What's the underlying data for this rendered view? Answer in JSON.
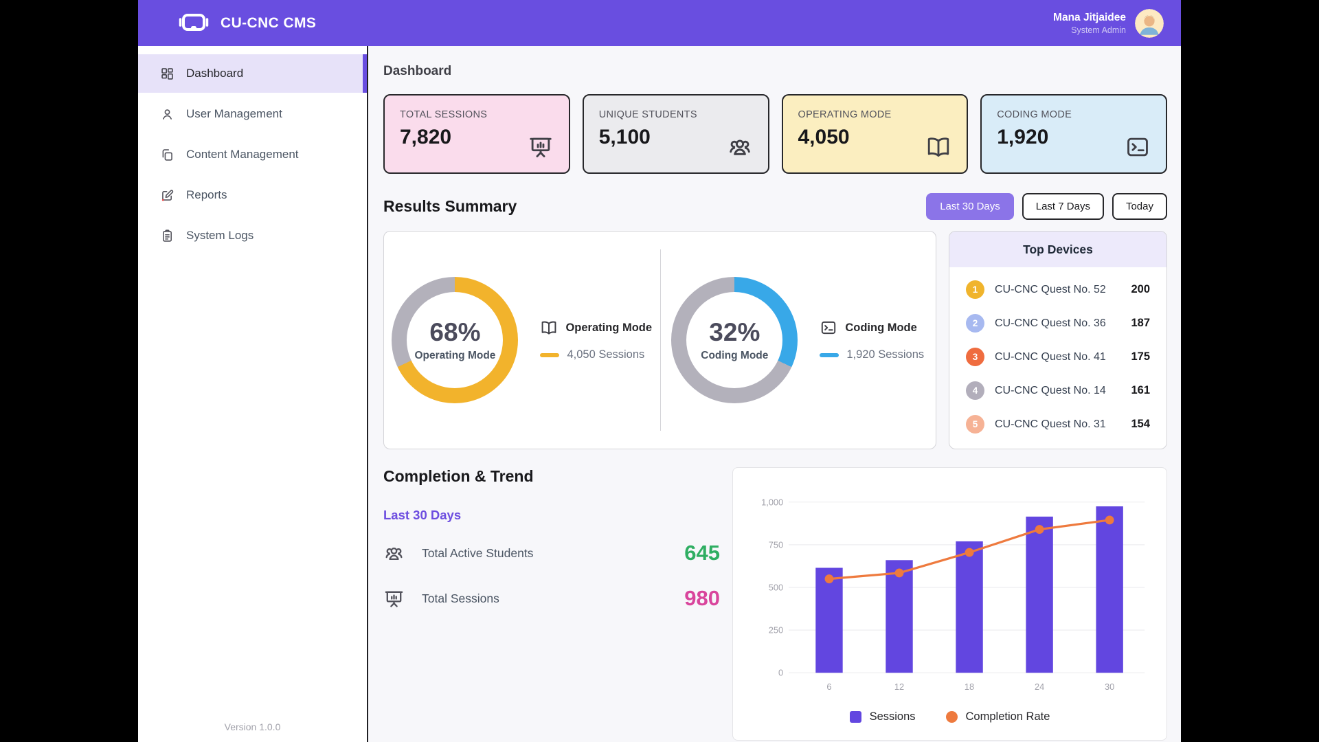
{
  "header": {
    "app_name": "CU-CNC CMS",
    "user": {
      "name": "Mana Jitjaidee",
      "role": "System Admin"
    }
  },
  "sidebar": {
    "items": [
      {
        "id": "dashboard",
        "label": "Dashboard",
        "icon": "dashboard-grid-icon",
        "active": true
      },
      {
        "id": "user-management",
        "label": "User Management",
        "icon": "user-icon",
        "active": false
      },
      {
        "id": "content-management",
        "label": "Content Management",
        "icon": "copy-icon",
        "active": false
      },
      {
        "id": "reports",
        "label": "Reports",
        "icon": "edit-icon",
        "active": false
      },
      {
        "id": "system-logs",
        "label": "System Logs",
        "icon": "clipboard-icon",
        "active": false
      }
    ],
    "version": "Version 1.0.0"
  },
  "page": {
    "title": "Dashboard"
  },
  "stat_cards": [
    {
      "label": "TOTAL SESSIONS",
      "value": "7,820",
      "icon": "presentation-chart-icon",
      "bg": "#fadcec"
    },
    {
      "label": "UNIQUE STUDENTS",
      "value": "5,100",
      "icon": "users-group-icon",
      "bg": "#ebebee"
    },
    {
      "label": "OPERATING MODE",
      "value": "4,050",
      "icon": "open-book-icon",
      "bg": "#fbeec0"
    },
    {
      "label": "CODING MODE",
      "value": "1,920",
      "icon": "terminal-icon",
      "bg": "#d9ecf8"
    }
  ],
  "results_summary": {
    "title": "Results Summary",
    "filters": [
      {
        "label": "Last 30 Days",
        "active": true
      },
      {
        "label": "Last 7 Days",
        "active": false
      },
      {
        "label": "Today",
        "active": false
      }
    ]
  },
  "donuts": [
    {
      "percent_text": "68%",
      "percent": 68,
      "center_label": "Operating Mode",
      "legend_title": "Operating Mode",
      "legend_value": "4,050 Sessions",
      "color": "#f2b32c",
      "rest_color": "#b3b1bb",
      "icon": "open-book-icon"
    },
    {
      "percent_text": "32%",
      "percent": 32,
      "center_label": "Coding Mode",
      "legend_title": "Coding Mode",
      "legend_value": "1,920 Sessions",
      "color": "#38a8e8",
      "rest_color": "#b3b1bb",
      "icon": "terminal-icon"
    }
  ],
  "top_devices": {
    "title": "Top Devices",
    "items": [
      {
        "rank": "1",
        "name": "CU-CNC Quest No. 52",
        "value": "200",
        "badge_color": "#f0b42c"
      },
      {
        "rank": "2",
        "name": "CU-CNC Quest No. 36",
        "value": "187",
        "badge_color": "#a7b9f0"
      },
      {
        "rank": "3",
        "name": "CU-CNC Quest No. 41",
        "value": "175",
        "badge_color": "#ef6c3f"
      },
      {
        "rank": "4",
        "name": "CU-CNC Quest No. 14",
        "value": "161",
        "badge_color": "#b2aebb"
      },
      {
        "rank": "5",
        "name": "CU-CNC Quest No. 31",
        "value": "154",
        "badge_color": "#f6b295"
      }
    ]
  },
  "completion_trend": {
    "title": "Completion & Trend",
    "period": "Last 30 Days",
    "stats": [
      {
        "label": "Total Active Students",
        "value": "645",
        "color": "#2fae62",
        "icon": "users-group-icon"
      },
      {
        "label": "Total Sessions",
        "value": "980",
        "color": "#d9459c",
        "icon": "presentation-chart-icon"
      }
    ]
  },
  "chart_data": {
    "type": "bar",
    "categories": [
      "6",
      "12",
      "18",
      "24",
      "30"
    ],
    "series": [
      {
        "name": "Sessions",
        "type": "bar",
        "color": "#6246e0",
        "values": [
          615,
          660,
          770,
          915,
          975
        ]
      },
      {
        "name": "Completion Rate",
        "type": "line",
        "color": "#ee7a3e",
        "values": [
          550,
          585,
          705,
          840,
          895
        ]
      }
    ],
    "title": "",
    "xlabel": "",
    "ylabel": "",
    "ylim": [
      0,
      1000
    ],
    "ytick_values": [
      0,
      250,
      500,
      750,
      1000
    ],
    "yticks": [
      "0",
      "250",
      "500",
      "750",
      "1,000"
    ],
    "grid": true,
    "legend_position": "bottom"
  }
}
